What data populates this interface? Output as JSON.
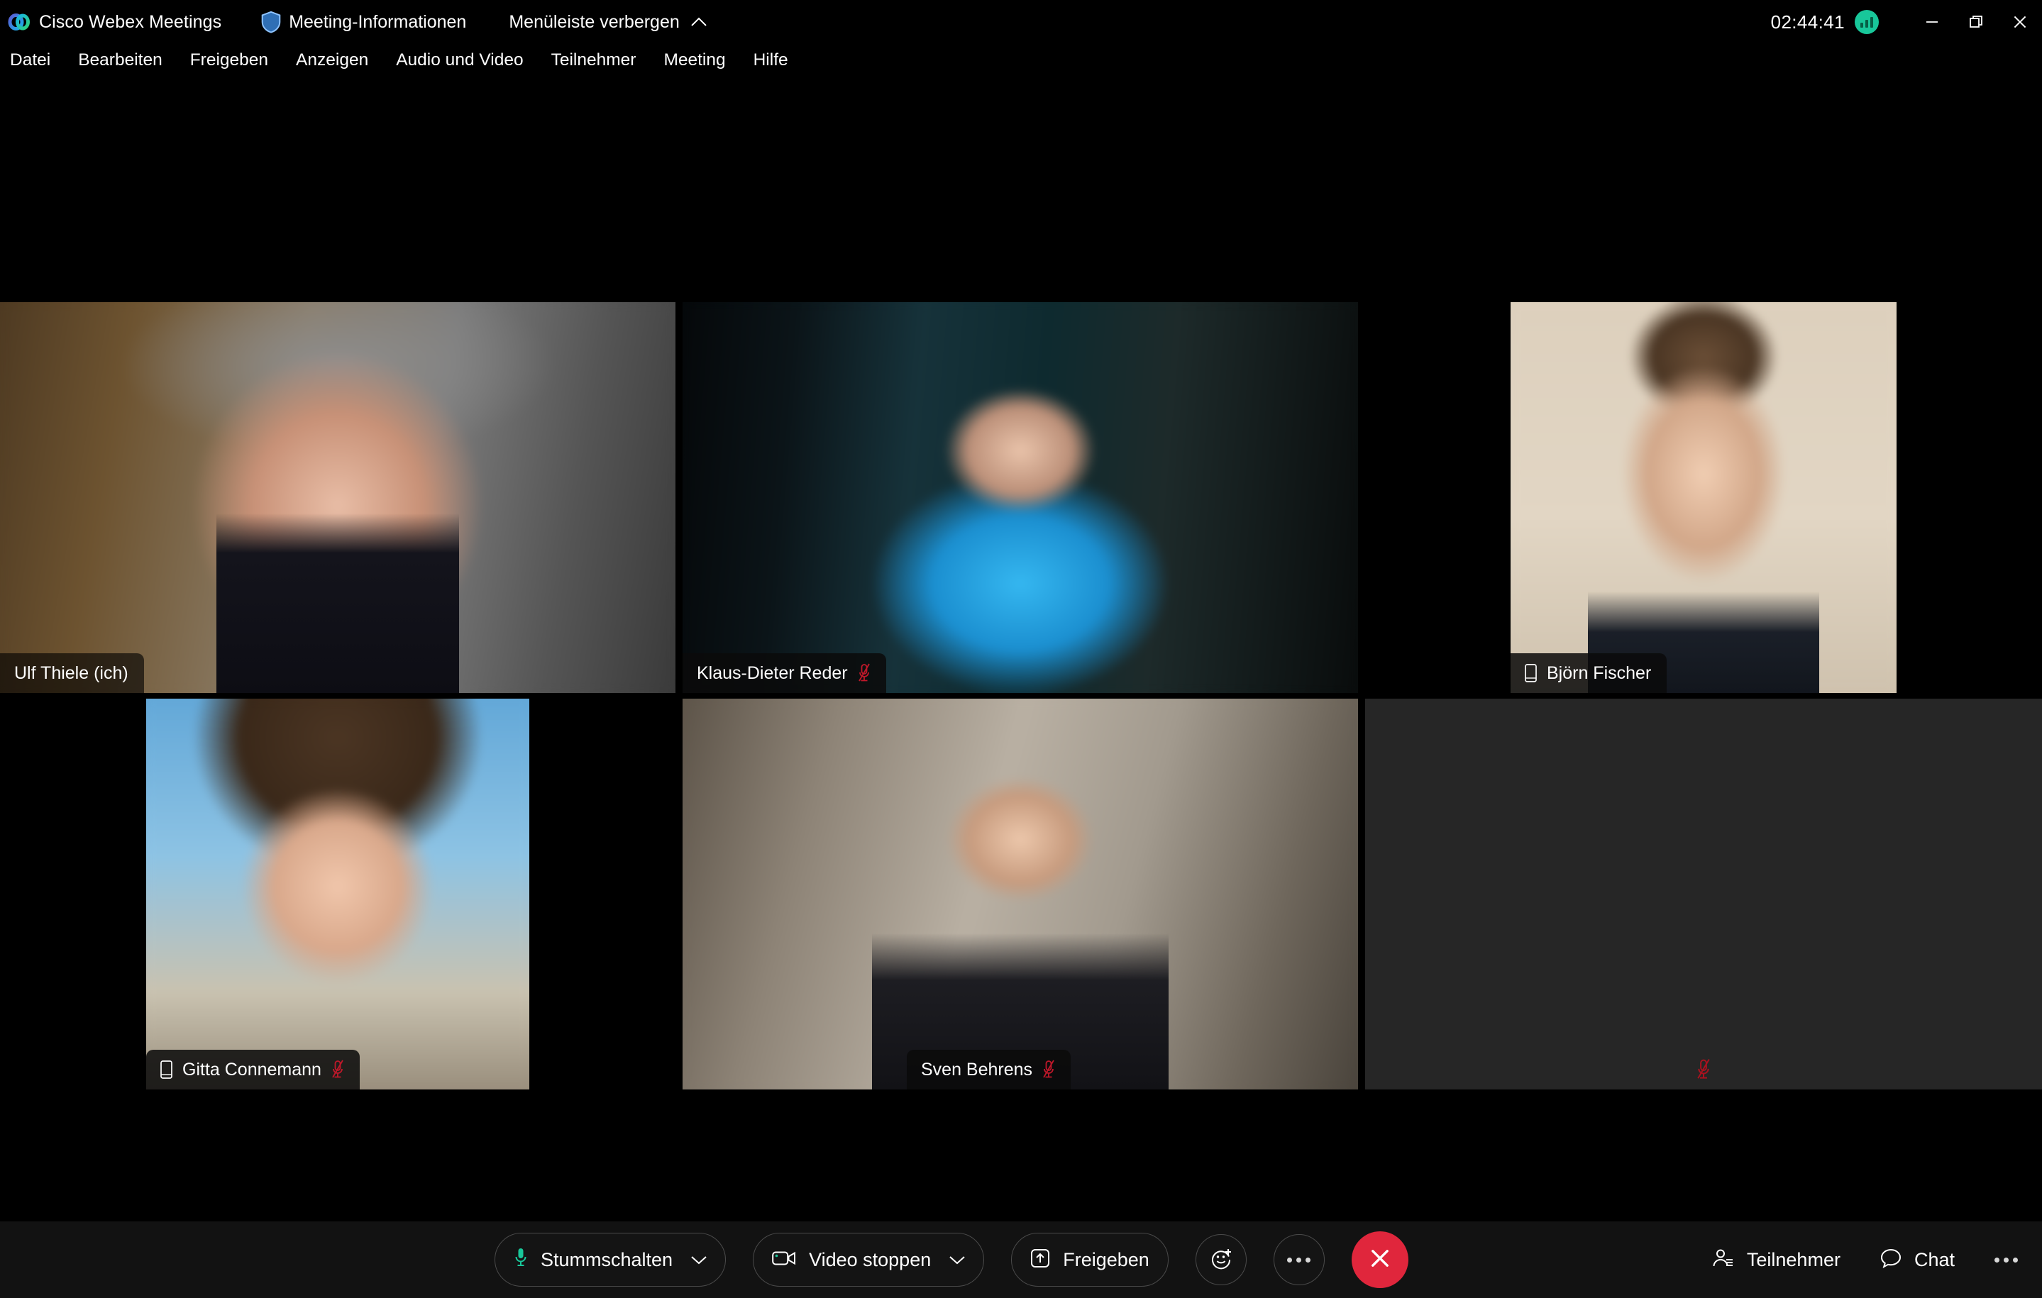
{
  "titlebar": {
    "app_title": "Cisco Webex Meetings",
    "logo_icon": "webex-logo-icon",
    "meeting_info_label": "Meeting-Informationen",
    "meeting_info_icon": "shield-icon",
    "hide_menubar_label": "Menüleiste verbergen",
    "hide_menubar_icon": "chevron-up-icon",
    "timer": "02:44:41",
    "network_icon": "network-signal-icon",
    "network_color": "#18c79a",
    "minimize_icon": "minimize-icon",
    "restore_icon": "restore-icon",
    "close_icon": "close-icon"
  },
  "menubar": {
    "items": [
      {
        "label": "Datei"
      },
      {
        "label": "Bearbeiten"
      },
      {
        "label": "Freigeben"
      },
      {
        "label": "Anzeigen"
      },
      {
        "label": "Audio und Video"
      },
      {
        "label": "Teilnehmer"
      },
      {
        "label": "Meeting"
      },
      {
        "label": "Hilfe"
      }
    ]
  },
  "stage": {
    "active_border_color": "#18b3e8",
    "muted_icon_color": "#c0182a",
    "tiles": [
      {
        "name": "Ulf Thiele (ich)",
        "active_speaker": true,
        "muted": false,
        "mobile": false,
        "has_video": true
      },
      {
        "name": "Klaus-Dieter Reder",
        "active_speaker": false,
        "muted": true,
        "mobile": false,
        "has_video": true
      },
      {
        "name": "Björn Fischer",
        "active_speaker": true,
        "muted": false,
        "mobile": true,
        "has_video": true
      },
      {
        "name": "Gitta Connemann",
        "active_speaker": false,
        "muted": true,
        "mobile": true,
        "has_video": true
      },
      {
        "name": "Sven Behrens",
        "active_speaker": false,
        "muted": true,
        "mobile": false,
        "has_video": true
      },
      {
        "name": "",
        "active_speaker": false,
        "muted": true,
        "mobile": false,
        "has_video": false
      }
    ]
  },
  "toolbar": {
    "mute_label": "Stummschalten",
    "mute_icon": "microphone-icon",
    "mute_icon_color": "#19c79a",
    "mute_caret_icon": "chevron-down-icon",
    "video_label": "Video stoppen",
    "video_icon": "camera-icon",
    "video_caret_icon": "chevron-down-icon",
    "share_label": "Freigeben",
    "share_icon": "share-upload-icon",
    "reactions_icon": "smiley-plus-icon",
    "more_icon": "more-horizontal-icon",
    "end_icon": "end-meeting-x-icon",
    "end_color": "#e0263c",
    "participants_label": "Teilnehmer",
    "participants_icon": "participants-icon",
    "chat_label": "Chat",
    "chat_icon": "chat-bubble-icon",
    "overflow_icon": "more-horizontal-icon"
  }
}
